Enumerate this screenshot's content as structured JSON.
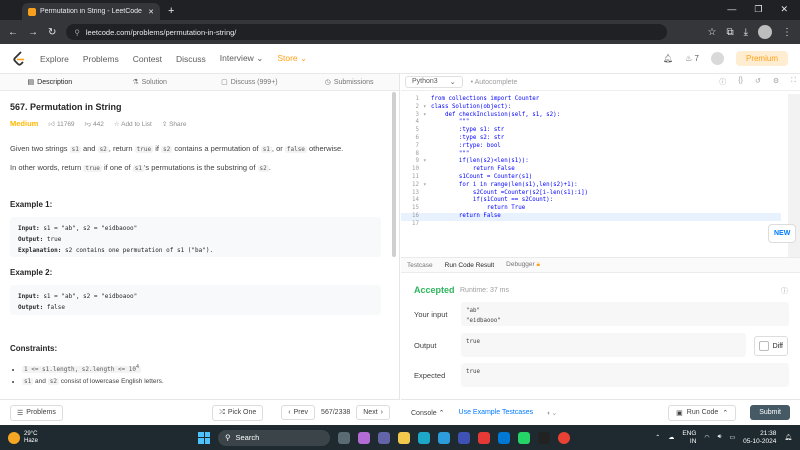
{
  "browser": {
    "tab_title": "Permutation in String - LeetCode",
    "url": "leetcode.com/problems/permutation-in-string/"
  },
  "nav": {
    "items": [
      "Explore",
      "Problems",
      "Contest",
      "Discuss",
      "Interview"
    ],
    "store": "Store",
    "notif_count": "7",
    "premium": "Premium"
  },
  "left_tabs": [
    "Description",
    "Solution",
    "Discuss (999+)",
    "Submissions"
  ],
  "problem": {
    "title": "567. Permutation in String",
    "difficulty": "Medium",
    "likes": "11769",
    "dislikes": "442",
    "add_to_list": "Add to List",
    "share": "Share",
    "desc1_a": "Given two strings",
    "desc1_s1": "s1",
    "desc1_and": "and",
    "desc1_s2": "s2",
    "desc1_b": ", return",
    "desc1_true": "true",
    "desc1_c": "if",
    "desc1_s2b": "s2",
    "desc1_d": "contains a permutation of",
    "desc1_s1b": "s1",
    "desc1_e": ", or",
    "desc1_false": "false",
    "desc1_f": "otherwise.",
    "desc2_a": "In other words, return",
    "desc2_true": "true",
    "desc2_b": "if one of",
    "desc2_s1": "s1",
    "desc2_c": "'s permutations is the substring of",
    "desc2_s2": "s2",
    "desc2_d": ".",
    "example1_h": "Example 1:",
    "ex1_input_label": "Input:",
    "ex1_input": "s1 = \"ab\", s2 = \"eidbaooo\"",
    "ex1_output_label": "Output:",
    "ex1_output": "true",
    "ex1_expl_label": "Explanation:",
    "ex1_expl": "s2 contains one permutation of s1 (\"ba\").",
    "example2_h": "Example 2:",
    "ex2_input_label": "Input:",
    "ex2_input": "s1 = \"ab\", s2 = \"eidboaoo\"",
    "ex2_output_label": "Output:",
    "ex2_output": "false",
    "constraints_h": "Constraints:",
    "c1": "1 <= s1.length, s2.length <= 10",
    "c1_sup": "4",
    "c2_s1": "s1",
    "c2_and": "and",
    "c2_s2": "s2",
    "c2_rest": "consist of lowercase English letters."
  },
  "bottom_left": {
    "problems": "Problems",
    "pick_one": "Pick One",
    "prev": "Prev",
    "counter": "567/2338",
    "next": "Next"
  },
  "editor": {
    "language": "Python3",
    "autocomplete": "Autocomplete",
    "lines": [
      "from collections import Counter",
      "class Solution(object):",
      "    def checkInclusion(self, s1, s2):",
      "        \"\"\"",
      "        :type s1: str",
      "        :type s2: str",
      "        :rtype: bool",
      "        \"\"\"",
      "        if(len(s2)<len(s1)):",
      "            return False",
      "        s1Count = Counter(s1)",
      "        for i in range(len(s1),len(s2)+1):",
      "            s2Count =Counter(s2[i-len(s1):i])",
      "            if(s1Count == s2Count):",
      "                return True",
      "        return False",
      ""
    ],
    "new_badge": "NEW"
  },
  "results": {
    "tabs": [
      "Testcase",
      "Run Code Result",
      "Debugger"
    ],
    "status": "Accepted",
    "runtime": "Runtime: 37 ms",
    "your_input_label": "Your input",
    "your_input_1": "\"ab\"",
    "your_input_2": "\"eidbaooo\"",
    "output_label": "Output",
    "output": "true",
    "expected_label": "Expected",
    "expected": "true",
    "diff": "Diff"
  },
  "bottom_right": {
    "console": "Console",
    "use_example": "Use Example Testcases",
    "run_code": "Run Code",
    "submit": "Submit"
  },
  "taskbar": {
    "temp": "29°C",
    "weather": "Haze",
    "search": "Search",
    "lang1": "ENG",
    "lang2": "IN",
    "time": "21:38",
    "date": "05-10-2024"
  },
  "colors": {
    "accepted": "#2db55d",
    "medium": "#ffb800",
    "brand": "#ffa116"
  }
}
